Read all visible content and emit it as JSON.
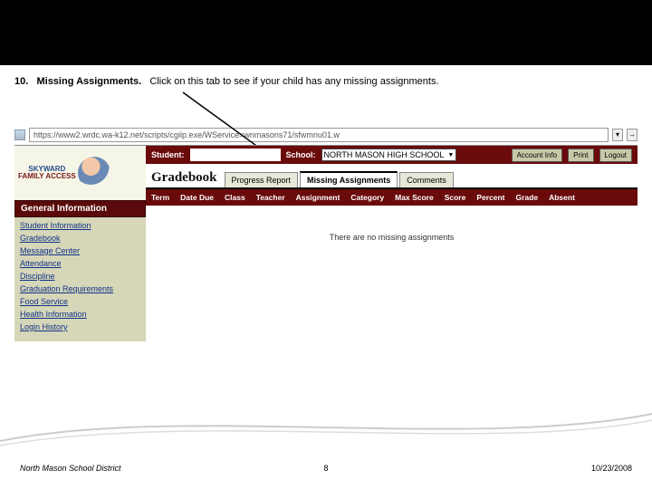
{
  "instruction": {
    "number": "10.",
    "title": "Missing Assignments.",
    "body": "Click on this tab to see if your child has any missing assignments."
  },
  "url": "https://www2.wrdc.wa-k12.net/scripts/cgiip.exe/WService=wnmasons71/sfwmnu01.w",
  "logo": {
    "brand": "SKYWARD",
    "sub": "FAMILY ACCESS"
  },
  "sidebar": {
    "header": "General Information",
    "items": [
      "Student Information",
      "Gradebook",
      "Message Center",
      "Attendance",
      "Discipline",
      "Graduation Requirements",
      "Food Service",
      "Health Information",
      "Login History"
    ]
  },
  "topbar": {
    "student_label": "Student:",
    "school_label": "School:",
    "school_value": "NORTH MASON HIGH SCHOOL",
    "buttons": {
      "account": "Account Info",
      "print": "Print",
      "logout": "Logout"
    }
  },
  "gradebook": {
    "title": "Gradebook",
    "tabs": [
      "Progress Report",
      "Missing Assignments",
      "Comments"
    ],
    "active_tab": 1,
    "columns": [
      "Term",
      "Date Due",
      "Class",
      "Teacher",
      "Assignment",
      "Category",
      "Max Score",
      "Score",
      "Percent",
      "Grade",
      "Absent"
    ],
    "empty_msg": "There are no missing assignments"
  },
  "footer": {
    "left": "North Mason School District",
    "center": "8",
    "right": "10/23/2008"
  }
}
